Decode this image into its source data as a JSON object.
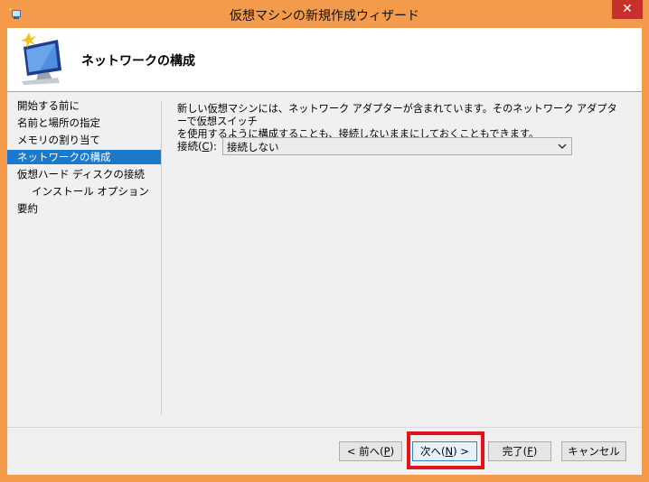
{
  "window": {
    "title": "仮想マシンの新規作成ウィザード",
    "close_glyph": "✕"
  },
  "header": {
    "title": "ネットワークの構成",
    "icon": "new-vm-monitor-icon"
  },
  "nav": {
    "items": [
      {
        "label": "開始する前に"
      },
      {
        "label": "名前と場所の指定"
      },
      {
        "label": "メモリの割り当て"
      },
      {
        "label": "ネットワークの構成",
        "selected": true
      },
      {
        "label": "仮想ハード ディスクの接続"
      },
      {
        "label": "インストール オプション",
        "indent": true
      },
      {
        "label": "要約"
      }
    ]
  },
  "content": {
    "description_line1": "新しい仮想マシンには、ネットワーク アダプターが含まれています。そのネットワーク アダプターで仮想スイッチ",
    "description_line2": "を使用するように構成することも、接続しないままにしておくこともできます。",
    "connection": {
      "label_prefix": "接続(",
      "label_accel": "C",
      "label_suffix": "):",
      "selected": "接続しない"
    }
  },
  "buttons": {
    "back": {
      "prefix": "< 前へ(",
      "accel": "P",
      "suffix": ")"
    },
    "next": {
      "prefix": "次へ(",
      "accel": "N",
      "suffix": ") >"
    },
    "finish": {
      "prefix": "完了(",
      "accel": "F",
      "suffix": ")"
    },
    "cancel": {
      "label": "キャンセル"
    }
  },
  "colors": {
    "titlebar": "#f39a4b",
    "close_button": "#c7312b",
    "nav_selected": "#1979ca",
    "highlight_box": "#e0141a"
  }
}
